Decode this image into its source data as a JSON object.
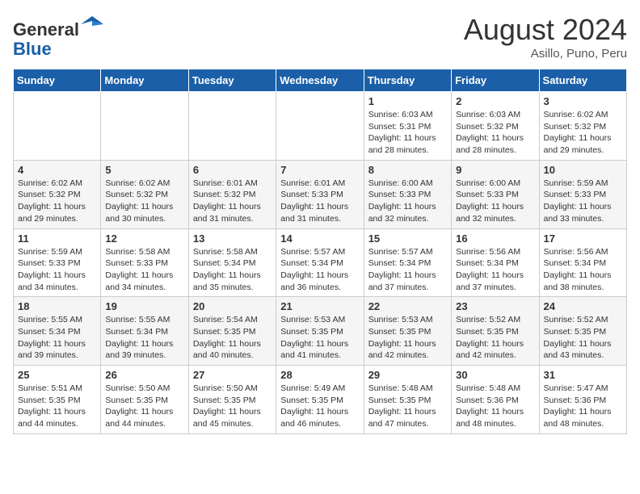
{
  "header": {
    "logo_general": "General",
    "logo_blue": "Blue",
    "month_year": "August 2024",
    "location": "Asillo, Puno, Peru"
  },
  "weekdays": [
    "Sunday",
    "Monday",
    "Tuesday",
    "Wednesday",
    "Thursday",
    "Friday",
    "Saturday"
  ],
  "weeks": [
    [
      {
        "day": "",
        "info": ""
      },
      {
        "day": "",
        "info": ""
      },
      {
        "day": "",
        "info": ""
      },
      {
        "day": "",
        "info": ""
      },
      {
        "day": "1",
        "info": "Sunrise: 6:03 AM\nSunset: 5:31 PM\nDaylight: 11 hours\nand 28 minutes."
      },
      {
        "day": "2",
        "info": "Sunrise: 6:03 AM\nSunset: 5:32 PM\nDaylight: 11 hours\nand 28 minutes."
      },
      {
        "day": "3",
        "info": "Sunrise: 6:02 AM\nSunset: 5:32 PM\nDaylight: 11 hours\nand 29 minutes."
      }
    ],
    [
      {
        "day": "4",
        "info": "Sunrise: 6:02 AM\nSunset: 5:32 PM\nDaylight: 11 hours\nand 29 minutes."
      },
      {
        "day": "5",
        "info": "Sunrise: 6:02 AM\nSunset: 5:32 PM\nDaylight: 11 hours\nand 30 minutes."
      },
      {
        "day": "6",
        "info": "Sunrise: 6:01 AM\nSunset: 5:32 PM\nDaylight: 11 hours\nand 31 minutes."
      },
      {
        "day": "7",
        "info": "Sunrise: 6:01 AM\nSunset: 5:33 PM\nDaylight: 11 hours\nand 31 minutes."
      },
      {
        "day": "8",
        "info": "Sunrise: 6:00 AM\nSunset: 5:33 PM\nDaylight: 11 hours\nand 32 minutes."
      },
      {
        "day": "9",
        "info": "Sunrise: 6:00 AM\nSunset: 5:33 PM\nDaylight: 11 hours\nand 32 minutes."
      },
      {
        "day": "10",
        "info": "Sunrise: 5:59 AM\nSunset: 5:33 PM\nDaylight: 11 hours\nand 33 minutes."
      }
    ],
    [
      {
        "day": "11",
        "info": "Sunrise: 5:59 AM\nSunset: 5:33 PM\nDaylight: 11 hours\nand 34 minutes."
      },
      {
        "day": "12",
        "info": "Sunrise: 5:58 AM\nSunset: 5:33 PM\nDaylight: 11 hours\nand 34 minutes."
      },
      {
        "day": "13",
        "info": "Sunrise: 5:58 AM\nSunset: 5:34 PM\nDaylight: 11 hours\nand 35 minutes."
      },
      {
        "day": "14",
        "info": "Sunrise: 5:57 AM\nSunset: 5:34 PM\nDaylight: 11 hours\nand 36 minutes."
      },
      {
        "day": "15",
        "info": "Sunrise: 5:57 AM\nSunset: 5:34 PM\nDaylight: 11 hours\nand 37 minutes."
      },
      {
        "day": "16",
        "info": "Sunrise: 5:56 AM\nSunset: 5:34 PM\nDaylight: 11 hours\nand 37 minutes."
      },
      {
        "day": "17",
        "info": "Sunrise: 5:56 AM\nSunset: 5:34 PM\nDaylight: 11 hours\nand 38 minutes."
      }
    ],
    [
      {
        "day": "18",
        "info": "Sunrise: 5:55 AM\nSunset: 5:34 PM\nDaylight: 11 hours\nand 39 minutes."
      },
      {
        "day": "19",
        "info": "Sunrise: 5:55 AM\nSunset: 5:34 PM\nDaylight: 11 hours\nand 39 minutes."
      },
      {
        "day": "20",
        "info": "Sunrise: 5:54 AM\nSunset: 5:35 PM\nDaylight: 11 hours\nand 40 minutes."
      },
      {
        "day": "21",
        "info": "Sunrise: 5:53 AM\nSunset: 5:35 PM\nDaylight: 11 hours\nand 41 minutes."
      },
      {
        "day": "22",
        "info": "Sunrise: 5:53 AM\nSunset: 5:35 PM\nDaylight: 11 hours\nand 42 minutes."
      },
      {
        "day": "23",
        "info": "Sunrise: 5:52 AM\nSunset: 5:35 PM\nDaylight: 11 hours\nand 42 minutes."
      },
      {
        "day": "24",
        "info": "Sunrise: 5:52 AM\nSunset: 5:35 PM\nDaylight: 11 hours\nand 43 minutes."
      }
    ],
    [
      {
        "day": "25",
        "info": "Sunrise: 5:51 AM\nSunset: 5:35 PM\nDaylight: 11 hours\nand 44 minutes."
      },
      {
        "day": "26",
        "info": "Sunrise: 5:50 AM\nSunset: 5:35 PM\nDaylight: 11 hours\nand 44 minutes."
      },
      {
        "day": "27",
        "info": "Sunrise: 5:50 AM\nSunset: 5:35 PM\nDaylight: 11 hours\nand 45 minutes."
      },
      {
        "day": "28",
        "info": "Sunrise: 5:49 AM\nSunset: 5:35 PM\nDaylight: 11 hours\nand 46 minutes."
      },
      {
        "day": "29",
        "info": "Sunrise: 5:48 AM\nSunset: 5:35 PM\nDaylight: 11 hours\nand 47 minutes."
      },
      {
        "day": "30",
        "info": "Sunrise: 5:48 AM\nSunset: 5:36 PM\nDaylight: 11 hours\nand 48 minutes."
      },
      {
        "day": "31",
        "info": "Sunrise: 5:47 AM\nSunset: 5:36 PM\nDaylight: 11 hours\nand 48 minutes."
      }
    ]
  ]
}
